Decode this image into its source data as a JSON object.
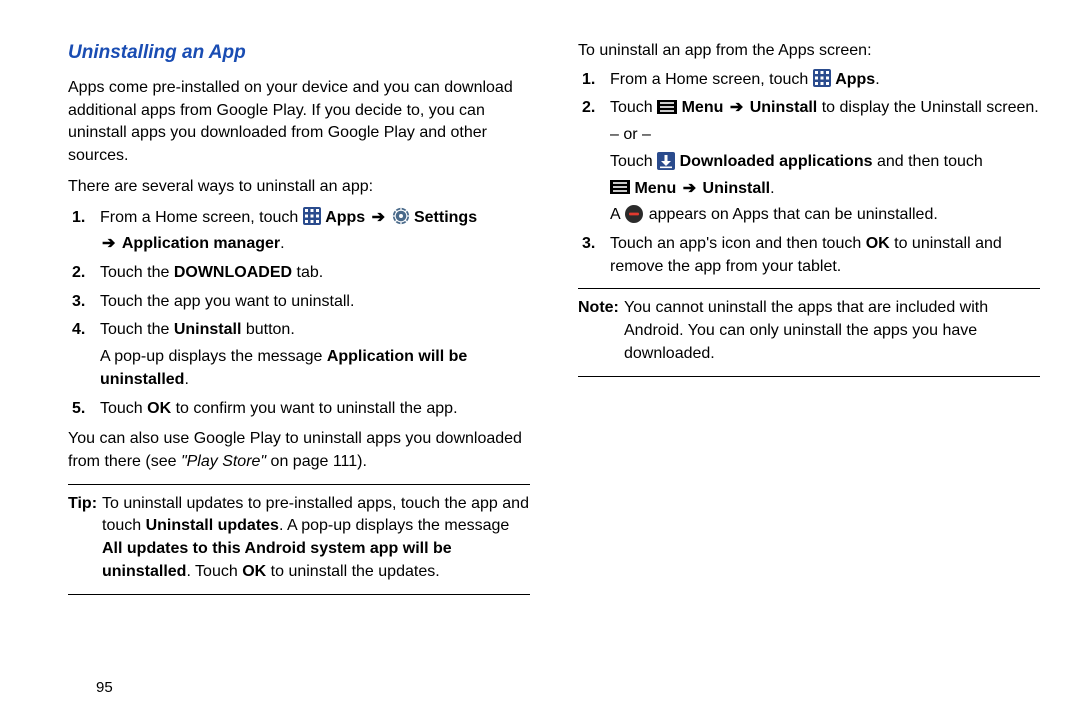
{
  "left": {
    "heading": "Uninstalling an App",
    "intro": "Apps come pre-installed on your device and you can download additional apps from Google Play. If you decide to, you can uninstall apps you downloaded from Google Play and other sources.",
    "ways": "There are several ways to uninstall an app:",
    "steps": {
      "1_a": "From a Home screen, touch ",
      "1_apps": " Apps",
      "1_arrow1": " ➔ ",
      "1_settings": " Settings",
      "1_arrow2": "➔ ",
      "1_appmgr": "Application manager",
      "1_dot": ".",
      "2_a": "Touch the ",
      "2_b": "DOWNLOADED",
      "2_c": " tab.",
      "3": "Touch the app you want to uninstall.",
      "4_a": "Touch the ",
      "4_b": "Uninstall",
      "4_c": " button.",
      "4_sub_a": "A pop-up displays the message ",
      "4_sub_b": "Application will be uninstalled",
      "4_sub_c": ".",
      "5_a": "Touch ",
      "5_b": "OK",
      "5_c": " to confirm you want to uninstall the app."
    },
    "also_a": "You can also use Google Play to uninstall apps you downloaded from there (see ",
    "also_b": "\"Play Store\"",
    "also_c": " on page 111).",
    "tip_label": "Tip:",
    "tip_a": "To uninstall updates to pre-installed apps, touch the app and touch ",
    "tip_b": "Uninstall updates",
    "tip_c": ". A pop-up displays the message ",
    "tip_d": "All updates to this Android system app will be uninstalled",
    "tip_e": ". Touch ",
    "tip_f": "OK",
    "tip_g": " to uninstall the updates."
  },
  "right": {
    "intro": "To uninstall an app from the Apps screen:",
    "steps": {
      "1_a": "From a Home screen, touch ",
      "1_apps": " Apps",
      "1_dot": ".",
      "2_a": "Touch ",
      "2_menu": " Menu",
      "2_arrow1": " ➔ ",
      "2_uninstall": "Uninstall",
      "2_b": " to display the Uninstall screen.",
      "or": "– or –",
      "2_c": "Touch ",
      "2_dl": " Downloaded applications",
      "2_d": " and then touch",
      "2_menu2": " Menu",
      "2_arrow2": " ➔ ",
      "2_uninstall2": "Uninstall",
      "2_dot": ".",
      "2_e": "A ",
      "2_f": " appears on Apps that can be uninstalled.",
      "3_a": "Touch an app's icon and then touch ",
      "3_b": "OK",
      "3_c": " to uninstall and remove the app from your tablet."
    },
    "note_label": "Note:",
    "note": "You cannot uninstall the apps that are included with Android. You can only uninstall the apps you have downloaded."
  },
  "page_number": "95"
}
